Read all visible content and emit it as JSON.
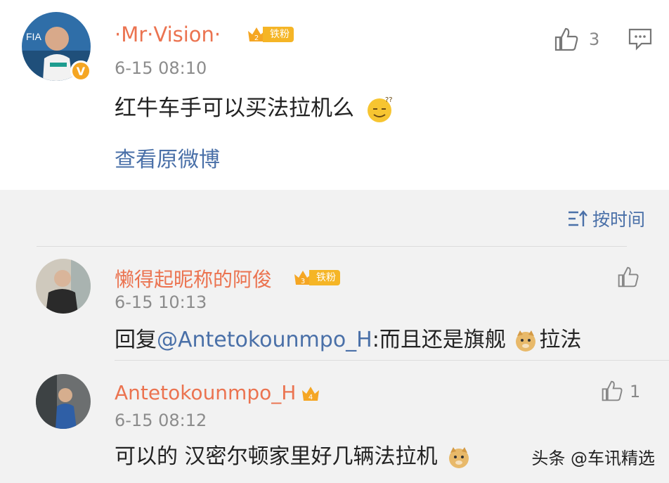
{
  "post": {
    "username": "·Mr·Vision·",
    "badge_level": "2",
    "badge_label": "铁粉",
    "verified_mark": "V",
    "timestamp": "6-15 08:10",
    "content": "红牛车手可以买法拉机么",
    "like_count": "3",
    "view_original_label": "查看原微博"
  },
  "sort": {
    "label": "按时间"
  },
  "comments": [
    {
      "username": "懒得起昵称的阿俊",
      "badge_level": "3",
      "badge_label": "铁粉",
      "timestamp": "6-15 10:13",
      "prefix": "回复",
      "mention": "@Antetokounmpo_H",
      "text": ":而且还是旗舰",
      "suffix": "拉法"
    },
    {
      "username": "Antetokounmpo_H",
      "badge_level": "4",
      "timestamp": "6-15 08:12",
      "text": "可以的 汉密尔顿家里好几辆法拉机",
      "like_count": "1"
    }
  ],
  "watermark": "头条 @车讯精选",
  "colors": {
    "username": "#eb7350",
    "link": "#4a70a8",
    "badge": "#f5b526"
  }
}
